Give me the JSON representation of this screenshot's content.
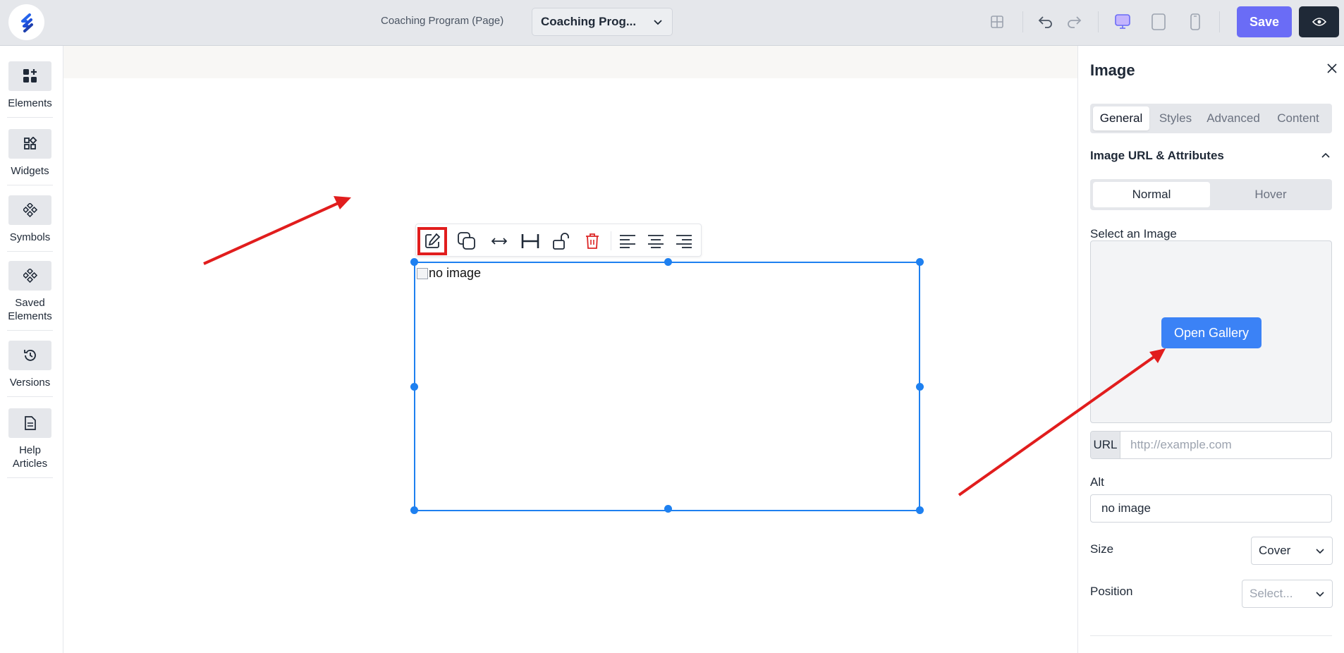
{
  "header": {
    "page_label": "Coaching Program (Page)",
    "page_select_value": "Coaching Prog...",
    "save_label": "Save"
  },
  "sidebar": {
    "items": [
      {
        "label": "Elements",
        "icon": "elements-icon"
      },
      {
        "label": "Widgets",
        "icon": "widgets-icon"
      },
      {
        "label": "Symbols",
        "icon": "symbols-icon"
      },
      {
        "label": "Saved Elements",
        "icon": "saved-elements-icon"
      },
      {
        "label": "Versions",
        "icon": "history-icon"
      },
      {
        "label": "Help Articles",
        "icon": "document-icon"
      }
    ]
  },
  "canvas": {
    "image_alt_text": "no image"
  },
  "panel": {
    "title": "Image",
    "tabs": [
      "General",
      "Styles",
      "Advanced",
      "Content"
    ],
    "active_tab": "General",
    "section_title": "Image URL & Attributes",
    "state_options": [
      "Normal",
      "Hover"
    ],
    "active_state": "Normal",
    "select_image_label": "Select an Image",
    "open_gallery_label": "Open Gallery",
    "url_prefix": "URL",
    "url_placeholder": "http://example.com",
    "alt_label": "Alt",
    "alt_value": "no image",
    "size_label": "Size",
    "size_value": "Cover",
    "position_label": "Position",
    "position_placeholder": "Select..."
  },
  "colors": {
    "accent": "#6a6cf6",
    "selection": "#1e80f0",
    "gallery_button": "#3b82f6",
    "annotation": "#e11d1d"
  }
}
